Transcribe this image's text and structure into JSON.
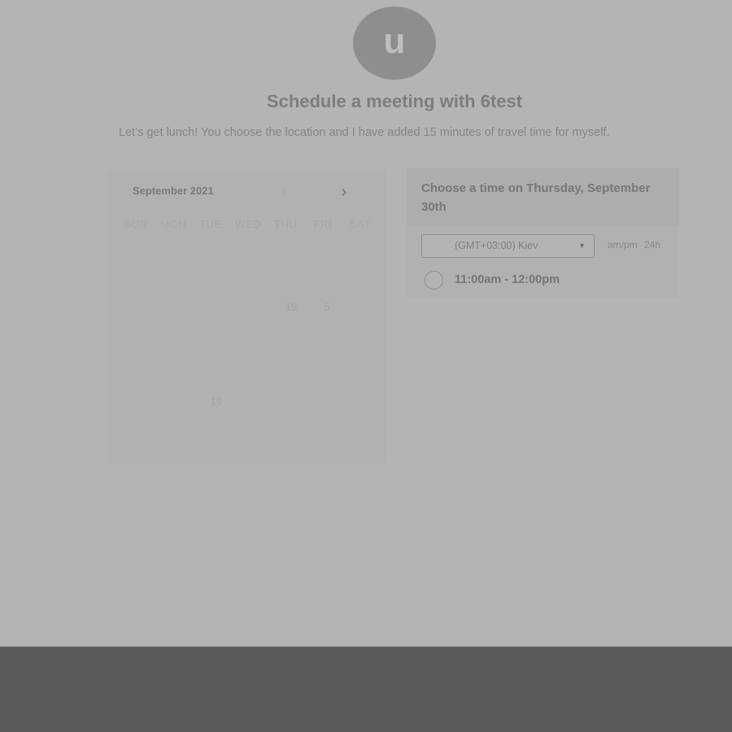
{
  "host": {
    "avatar_letter": "u",
    "title": "Schedule a meeting with 6test",
    "description": "Let’s get lunch! You choose the location and I have added 15 minutes of travel time for myself."
  },
  "calendar": {
    "month_label": "September 2021",
    "prev_icon": "chevron-left-icon",
    "next_icon": "chevron-right-icon",
    "weekdays": [
      "SUN",
      "MON",
      "TUE",
      "WED",
      "THU",
      "FRI",
      "SAT"
    ],
    "visible_days": [
      "19",
      "5",
      "19"
    ]
  },
  "time_picker": {
    "heading": "Choose a time on Thursday, September 30th",
    "timezone": "(GMT+03:00) Kiev",
    "format_ampm": "am/pm",
    "format_24h": "24h",
    "slots": [
      {
        "label": "11:00am - 12:00pm"
      }
    ]
  },
  "colors": {
    "overlay": "#b4b4b4",
    "bottom_band": "#5b5b5b"
  }
}
